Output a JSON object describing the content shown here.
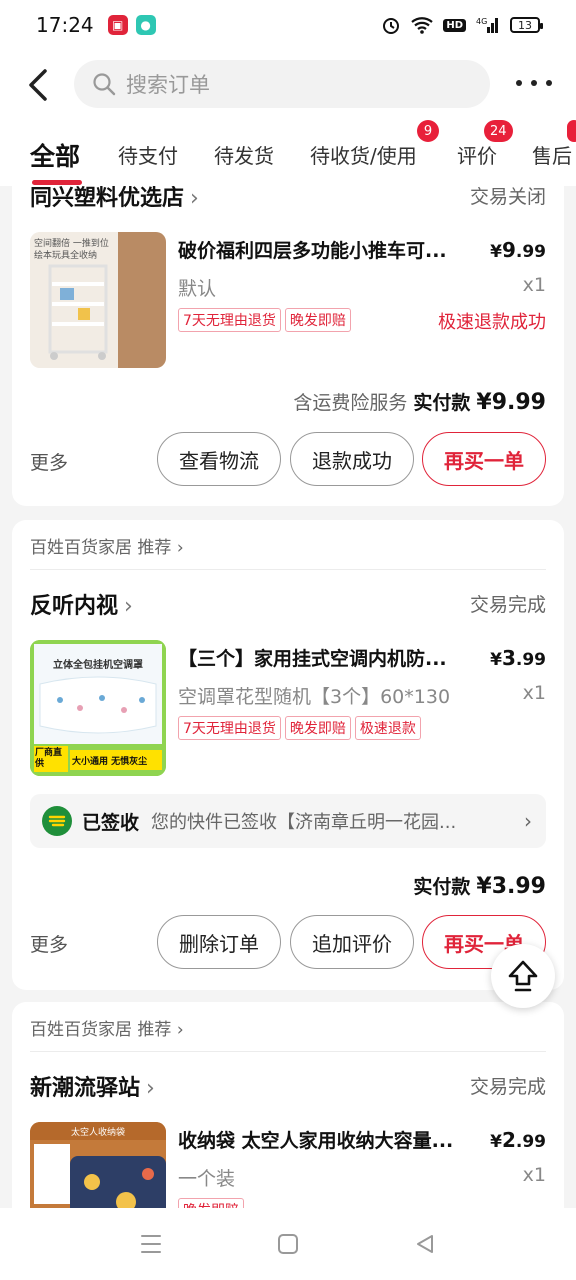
{
  "status_bar": {
    "time": "17:24",
    "network": "4G",
    "hd": "HD",
    "battery": "13"
  },
  "header": {
    "search_placeholder": "搜索订单"
  },
  "tabs": [
    {
      "label": "全部",
      "active": true
    },
    {
      "label": "待支付"
    },
    {
      "label": "待发货"
    },
    {
      "label": "待收货/使用",
      "badge": "9"
    },
    {
      "label": "评价",
      "badge": "24"
    },
    {
      "label": "售后"
    }
  ],
  "orders": [
    {
      "shop": "同兴塑料优选店",
      "status": "交易关闭",
      "item": {
        "title": "破价福利四层多功能小推车可...",
        "price_symbol": "¥",
        "price_int": "9",
        "price_dec": ".99",
        "spec": "默认",
        "qty": "x1",
        "tags": [
          "7天无理由退货",
          "晚发即赔"
        ],
        "refund_status": "极速退款成功",
        "thumb_caption": "空间翻倍 一推到位 绘本玩具全收纳"
      },
      "total": {
        "service": "含运费险服务",
        "label": "实付款",
        "amount": "¥9.99"
      },
      "more": "更多",
      "buttons": [
        "查看物流",
        "退款成功",
        "再买一单"
      ]
    },
    {
      "recommend": "百姓百货家居 推荐",
      "shop": "反听内视",
      "status": "交易完成",
      "item": {
        "title": "【三个】家用挂式空调内机防...",
        "price_symbol": "¥",
        "price_int": "3",
        "price_dec": ".99",
        "spec": "空调罩花型随机【3个】60*130",
        "qty": "x1",
        "tags": [
          "7天无理由退货",
          "晚发即赔",
          "极速退款"
        ],
        "thumb_caption": "立体全包挂机空调罩",
        "thumb_footer": [
          "厂商直供",
          "大小通用 无惧灰尘"
        ]
      },
      "logistics": {
        "title": "已签收",
        "text": "您的快件已签收【济南章丘明一花园..."
      },
      "total": {
        "label": "实付款",
        "amount": "¥3.99"
      },
      "more": "更多",
      "buttons": [
        "删除订单",
        "追加评价",
        "再买一单"
      ]
    },
    {
      "recommend": "百姓百货家居 推荐",
      "shop": "新潮流驿站",
      "status": "交易完成",
      "item": {
        "title": "收纳袋 太空人家用收纳大容量...",
        "price_symbol": "¥",
        "price_int": "2",
        "price_dec": ".99",
        "spec": "一个装",
        "qty": "x1",
        "tags": [
          "晚发即赔"
        ],
        "thumb_caption": "太空人收纳袋"
      }
    }
  ]
}
